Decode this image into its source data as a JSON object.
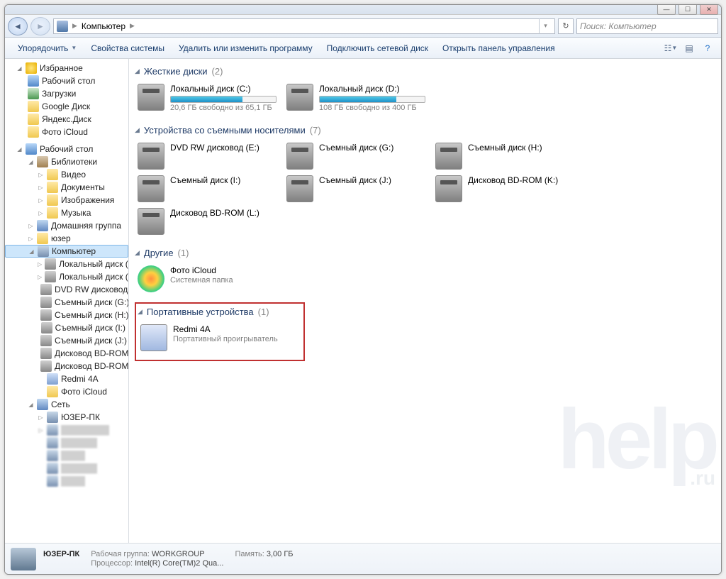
{
  "address": {
    "location": "Компьютер"
  },
  "search": {
    "placeholder": "Поиск: Компьютер"
  },
  "toolbar": {
    "organize": "Упорядочить",
    "system_props": "Свойства системы",
    "uninstall": "Удалить или изменить программу",
    "map_drive": "Подключить сетевой диск",
    "control_panel": "Открыть панель управления"
  },
  "tree": {
    "favorites": "Избранное",
    "fav_items": [
      "Рабочий стол",
      "Загрузки",
      "Google Диск",
      "Яндекс.Диск",
      "Фото iCloud"
    ],
    "desktop": "Рабочий стол",
    "libraries": "Библиотеки",
    "lib_items": [
      "Видео",
      "Документы",
      "Изображения",
      "Музыка"
    ],
    "homegroup": "Домашняя группа",
    "user": "юзер",
    "computer": "Компьютер",
    "comp_items": [
      "Локальный диск (C:)",
      "Локальный диск (D:)",
      "DVD RW дисковод (E:)",
      "Съемный диск (G:)",
      "Съемный диск (H:)",
      "Съемный диск (I:)",
      "Съемный диск (J:)",
      "Дисковод BD-ROM (K:)",
      "Дисковод BD-ROM (L:)",
      "Redmi 4A",
      "Фото iCloud"
    ],
    "network": "Сеть",
    "net_pc": "ЮЗЕР-ПК"
  },
  "sections": {
    "hdd": {
      "title": "Жесткие диски",
      "count": "(2)"
    },
    "removable": {
      "title": "Устройства со съемными носителями",
      "count": "(7)"
    },
    "other": {
      "title": "Другие",
      "count": "(1)"
    },
    "portable": {
      "title": "Портативные устройства",
      "count": "(1)"
    }
  },
  "drives": {
    "c": {
      "title": "Локальный диск (C:)",
      "sub": "20,6 ГБ свободно из 65,1 ГБ",
      "fill": 68
    },
    "d": {
      "title": "Локальный диск (D:)",
      "sub": "108 ГБ свободно из 400 ГБ",
      "fill": 73
    }
  },
  "removable": [
    "DVD RW дисковод (E:)",
    "Съемный диск (G:)",
    "Съемный диск (H:)",
    "Съемный диск (I:)",
    "Съемный диск (J:)",
    "Дисковод BD-ROM (K:)",
    "Дисковод BD-ROM (L:)"
  ],
  "other_item": {
    "title": "Фото iCloud",
    "sub": "Системная папка"
  },
  "portable_item": {
    "title": "Redmi 4A",
    "sub": "Портативный проигрыватель"
  },
  "status": {
    "name": "ЮЗЕР-ПК",
    "workgroup_label": "Рабочая группа:",
    "workgroup": "WORKGROUP",
    "mem_label": "Память:",
    "mem": "3,00 ГБ",
    "cpu_label": "Процессор:",
    "cpu": "Intel(R) Core(TM)2 Qua..."
  },
  "watermark": {
    "text": "help",
    "suffix": ".ru"
  }
}
